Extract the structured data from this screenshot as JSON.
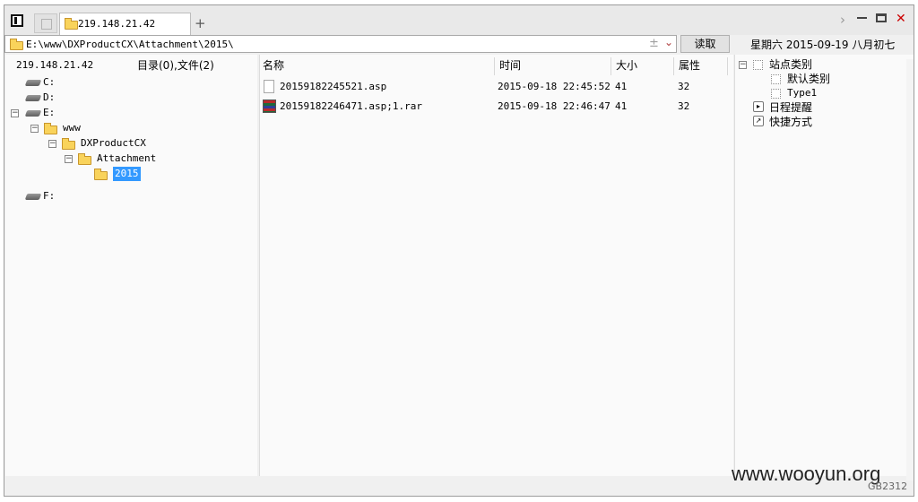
{
  "tabs": [
    {
      "label": ""
    },
    {
      "label": "219.148.21.42"
    }
  ],
  "address_bar": {
    "path": "E:\\www\\DXProductCX\\Attachment\\2015\\",
    "read_button": "读取"
  },
  "header_date": "星期六 2015-09-19 八月初七",
  "left_pane": {
    "host": "219.148.21.42",
    "summary": "目录(0),文件(2)",
    "tree": [
      {
        "label": "C:",
        "type": "drive",
        "level": 0,
        "expand": ""
      },
      {
        "label": "D:",
        "type": "drive",
        "level": 0,
        "expand": ""
      },
      {
        "label": "E:",
        "type": "drive",
        "level": 0,
        "expand": "−"
      },
      {
        "label": "www",
        "type": "folder",
        "level": 1,
        "expand": "−"
      },
      {
        "label": "DXProductCX",
        "type": "folder",
        "level": 2,
        "expand": "−"
      },
      {
        "label": "Attachment",
        "type": "folder",
        "level": 3,
        "expand": "−"
      },
      {
        "label": "2015",
        "type": "folder",
        "level": 4,
        "expand": "",
        "selected": true
      },
      {
        "label": "F:",
        "type": "drive",
        "level": 0,
        "expand": ""
      }
    ]
  },
  "file_list": {
    "columns": [
      "名称",
      "时间",
      "大小",
      "属性"
    ],
    "rows": [
      {
        "name": "20159182245521.asp",
        "time": "2015-09-18 22:45:52",
        "size": "41",
        "attr": "32",
        "icon": "file-icon"
      },
      {
        "name": "20159182246471.asp;1.rar",
        "time": "2015-09-18 22:46:47",
        "size": "41",
        "attr": "32",
        "icon": "rar-icon"
      }
    ]
  },
  "right_pane": {
    "site_category": "站点类别",
    "default_category": "默认类别",
    "type1": "Type1",
    "schedule": "日程提醒",
    "shortcut": "快捷方式"
  },
  "watermark": "www.wooyun.org",
  "encoding": "GB2312",
  "colors": {
    "selection": "#3399ff",
    "close": "#cc0000"
  }
}
